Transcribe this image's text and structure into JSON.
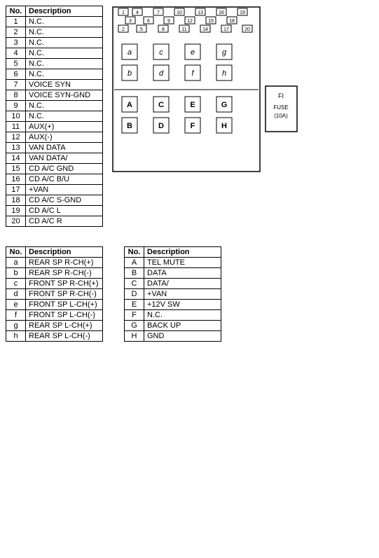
{
  "title": "No Description",
  "table1": {
    "headers": [
      "No.",
      "Description"
    ],
    "rows": [
      [
        "1",
        "N.C."
      ],
      [
        "2",
        "N.C."
      ],
      [
        "3",
        "N.C."
      ],
      [
        "4",
        "N.C."
      ],
      [
        "5",
        "N.C."
      ],
      [
        "6",
        "N.C."
      ],
      [
        "7",
        "VOICE SYN"
      ],
      [
        "8",
        "VOICE SYN-GND"
      ],
      [
        "9",
        "N.C."
      ],
      [
        "10",
        "N.C."
      ],
      [
        "11",
        "AUX(+)"
      ],
      [
        "12",
        "AUX(-)"
      ],
      [
        "13",
        "VAN DATA"
      ],
      [
        "14",
        "VAN DATA/"
      ],
      [
        "15",
        "CD A/C GND"
      ],
      [
        "16",
        "CD A/C B/U"
      ],
      [
        "17",
        "+VAN"
      ],
      [
        "18",
        "CD A/C S-GND"
      ],
      [
        "19",
        "CD A/C L"
      ],
      [
        "20",
        "CD A/C R"
      ]
    ]
  },
  "table2": {
    "headers": [
      "No.",
      "Description"
    ],
    "rows": [
      [
        "a",
        "REAR SP R-CH(+)"
      ],
      [
        "b",
        "REAR SP R-CH(-)"
      ],
      [
        "c",
        "FRONT SP R-CH(+)"
      ],
      [
        "d",
        "FRONT SP R-CH(-)"
      ],
      [
        "e",
        "FRONT SP L-CH(+)"
      ],
      [
        "f",
        "FRONT SP L-CH(-)"
      ],
      [
        "g",
        "REAR SP L-CH(+)"
      ],
      [
        "h",
        "REAR SP L-CH(-)"
      ]
    ]
  },
  "table3": {
    "headers": [
      "No.",
      "Description"
    ],
    "rows": [
      [
        "A",
        "TEL MUTE"
      ],
      [
        "B",
        "DATA"
      ],
      [
        "C",
        "DATA/"
      ],
      [
        "D",
        "+VAN"
      ],
      [
        "E",
        "+12V SW"
      ],
      [
        "F",
        "N.C."
      ],
      [
        "G",
        "BACK UP"
      ],
      [
        "H",
        "GND"
      ]
    ]
  },
  "connector": {
    "top_row": [
      "1",
      "4",
      "7",
      "10",
      "13",
      "16",
      "19"
    ],
    "second_row": [
      "3",
      "6",
      "9",
      "12",
      "15",
      "18"
    ],
    "third_row": [
      "2",
      "5",
      "8",
      "11",
      "14",
      "17",
      "20"
    ],
    "inner_top": [
      "a",
      "c",
      "e",
      "g"
    ],
    "inner_mid": [
      "b",
      "d",
      "f",
      "h"
    ],
    "bottom_left": [
      "A",
      "C",
      "E",
      "G"
    ],
    "bottom_right": [
      "B",
      "D",
      "F",
      "H"
    ],
    "fuse_label": "FI",
    "fuse_value": "FUSE (10A)"
  }
}
